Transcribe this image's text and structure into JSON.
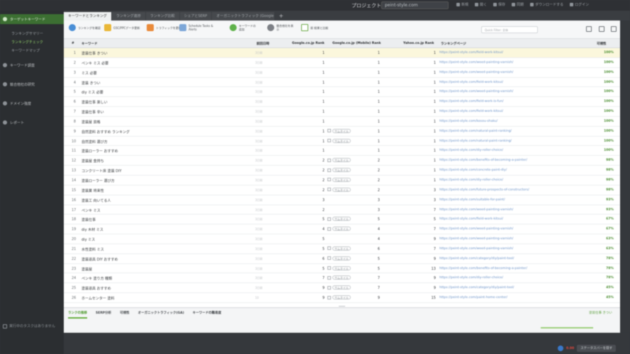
{
  "top": {
    "project_label": "プロジェクト：",
    "project_value": "peint-style.com",
    "actions": [
      "新規",
      "開く",
      "保存",
      "同期",
      "ダウンロードする",
      "ログイン"
    ]
  },
  "sidebar": {
    "category_active": "ターゲットキーワード",
    "subitems": [
      "ランキングサマリー",
      "ランキングチェック",
      "キーワードマップ"
    ],
    "categories": [
      "キーワード調査",
      "競合他社の研究",
      "ドメイン強度",
      "レポート"
    ],
    "bottom_label": "実行中のタスクはありません"
  },
  "tabs": [
    "キーワードとランキング",
    "ランキング進捗",
    "ランキング比較",
    "シェアとSERP",
    "オーガニックトラフィック (Google A..."
  ],
  "toolbar": {
    "buttons": [
      "ランキングを確認",
      "GSC/PPCデータ更新",
      "トラフィックを更新",
      "Schedule Tasks & Alerts",
      "キーワードの追加",
      "競合他社を表示",
      "前 結果と比較"
    ],
    "filter_placeholder": "Quick Filter: 全体"
  },
  "columns": {
    "num": "#",
    "keyword": "キーワード",
    "date": "前回日時",
    "google": "Google.co.jp Rank",
    "mobile": "Google.co.jp (Mobile) Rank",
    "yahoo": "Yahoo.co.jp Rank",
    "url": "ランキングページ",
    "visibility": "可視性"
  },
  "thumb_label": "サムネイル",
  "rows": [
    {
      "n": "1",
      "kw": "塗装仕事 きつい",
      "d": "3日前",
      "g": "1",
      "m": "1",
      "y": "1",
      "u": "https://peint-style.com/field-work-kitsui/",
      "v": "100%",
      "t": false
    },
    {
      "n": "2",
      "kw": "ペンキ ミス 必要",
      "d": "3日前",
      "g": "1",
      "m": "1",
      "y": "1",
      "u": "https://peint-style.com/weed-painting-varnish/",
      "v": "100%",
      "t": false
    },
    {
      "n": "3",
      "kw": "ミス 必要",
      "d": "3日前",
      "g": "1",
      "m": "1",
      "y": "1",
      "u": "https://peint-style.com/weed-painting-varnish/",
      "v": "100%",
      "t": false
    },
    {
      "n": "4",
      "kw": "塗装 きつい",
      "d": "3日前",
      "g": "1",
      "m": "1",
      "y": "1",
      "u": "https://peint-style.com/field-work-kitsui/",
      "v": "100%",
      "t": false
    },
    {
      "n": "5",
      "kw": "diy ミス 必要",
      "d": "3日前",
      "g": "1",
      "m": "1",
      "y": "1",
      "u": "https://peint-style.com/weed-painting-varnish/",
      "v": "100%",
      "t": false
    },
    {
      "n": "6",
      "kw": "塗装仕事 楽しい",
      "d": "3日前",
      "g": "1",
      "m": "1",
      "y": "1",
      "u": "https://peint-style.com/field-work-is-fun/",
      "v": "100%",
      "t": false
    },
    {
      "n": "7",
      "kw": "塗装仕事 辛い",
      "d": "3日前",
      "g": "1",
      "m": "1",
      "y": "1",
      "u": "https://peint-style.com/field-work-kitsui/",
      "v": "100%",
      "t": false
    },
    {
      "n": "8",
      "kw": "塗装屋 資格",
      "d": "3日前",
      "g": "1",
      "m": "1",
      "y": "1",
      "u": "https://peint-style.com/kosou-shaku/",
      "v": "100%",
      "t": false
    },
    {
      "n": "9",
      "kw": "自然塗料 おすすめ ランキング",
      "d": "3日前",
      "g": "1",
      "m": "1",
      "y": "1",
      "u": "https://peint-style.com/natural-paint-ranking/",
      "v": "100%",
      "t": true
    },
    {
      "n": "10",
      "kw": "自然塗料 選び方",
      "d": "3日前",
      "g": "1",
      "m": "1",
      "y": "1",
      "u": "https://peint-style.com/natural-paint-ranking/",
      "v": "100%",
      "t": true
    },
    {
      "n": "11",
      "kw": "塗装ローラー おすすめ",
      "d": "3日前",
      "g": "1",
      "m": "1",
      "y": "1",
      "u": "https://peint-style.com/diy-roller-choice/",
      "v": "100%",
      "t": false
    },
    {
      "n": "12",
      "kw": "塗装屋 金持ち",
      "d": "3日前",
      "g": "2",
      "m": "2",
      "y": "1",
      "u": "https://peint-style.com/benefits-of-becoming-a-painter/",
      "v": "98%",
      "t": true
    },
    {
      "n": "13",
      "kw": "コンクリート床 塗装 DIY",
      "d": "3日前",
      "g": "2",
      "m": "2",
      "y": "1",
      "u": "https://peint-style.com/concrete-paint-diy/",
      "v": "98%",
      "t": true
    },
    {
      "n": "14",
      "kw": "塗装ローラー 選び方",
      "d": "3日前",
      "g": "2",
      "m": "2",
      "y": "1",
      "u": "https://peint-style.com/diy-roller-choice/",
      "v": "98%",
      "t": true
    },
    {
      "n": "15",
      "kw": "塗装業 将来性",
      "d": "3日前",
      "g": "2",
      "m": "2",
      "y": "3",
      "u": "https://peint-style.com/future-prospects-of-constructors/",
      "v": "98%",
      "t": true
    },
    {
      "n": "16",
      "kw": "塗装工 向いてる人",
      "d": "3日前",
      "g": "3",
      "m": "3",
      "y": "3",
      "u": "https://peint-style.com/suitable-for-paint/",
      "v": "93%",
      "t": false
    },
    {
      "n": "17",
      "kw": "ペンキ ミス",
      "d": "3日前",
      "g": "2",
      "m": "3",
      "y": "7",
      "u": "https://peint-style.com/weed-painting-varnish/",
      "v": "93%",
      "t": false
    },
    {
      "n": "18",
      "kw": "塗装仕事",
      "d": "3日前",
      "g": "5",
      "m": "5",
      "y": "5",
      "u": "https://peint-style.com/field-work-kitsui/",
      "v": "67%",
      "t": true
    },
    {
      "n": "19",
      "kw": "diy 木材 ミス",
      "d": "3日前",
      "g": "4",
      "m": "4",
      "y": "7",
      "u": "https://peint-style.com/weed-painting-varnish/",
      "v": "67%",
      "t": true
    },
    {
      "n": "20",
      "kw": "diy ミス",
      "d": "3日前",
      "g": "5",
      "m": "4",
      "y": "9",
      "u": "https://peint-style.com/weed-painting-varnish/",
      "v": "63%",
      "t": false
    },
    {
      "n": "21",
      "kw": "水性塗料 ミス",
      "d": "3日前",
      "g": "5",
      "m": "6",
      "y": "7",
      "u": "https://peint-style.com/weed-painting-varnish/",
      "v": "63%",
      "t": true
    },
    {
      "n": "22",
      "kw": "塗装道具 DIY おすすめ",
      "d": "3日前",
      "g": "6",
      "m": "5",
      "y": "9",
      "u": "https://peint-style.com/category/diy/paint-tool/",
      "v": "78%",
      "t": true
    },
    {
      "n": "23",
      "kw": "塗装屋",
      "d": "3日前",
      "g": "5",
      "m": "5",
      "y": "13",
      "u": "https://peint-style.com/benefits-of-becoming-a-painter/",
      "v": "78%",
      "t": true
    },
    {
      "n": "24",
      "kw": "ペンキ 塗り方 種類",
      "d": "3日前",
      "g": "7",
      "m": "7",
      "y": "9",
      "u": "https://peint-style.com/diy-roller-choice/",
      "v": "78%",
      "t": true
    },
    {
      "n": "25",
      "kw": "塗装道具 おすすめ",
      "d": "3日前",
      "g": "9",
      "m": "7",
      "y": "9",
      "u": "https://peint-style.com/category/diy/paint-tool/",
      "v": "45%",
      "t": true
    },
    {
      "n": "26",
      "kw": "ホームセンター 塗料",
      "d": "10",
      "g": "9",
      "m": "9",
      "y": "15",
      "u": "https://peint-style.com/paint-home-center/",
      "v": "45%",
      "t": true
    }
  ],
  "bottom_panel": {
    "tabs": [
      "ランクの推移",
      "SERP分析",
      "可視性",
      "オーガニックトラフィック(GA)",
      "キーワードの難易度"
    ],
    "right_label": "塗装仕事 きつい"
  },
  "status": {
    "count": "0.00",
    "button": "ステータスバーを隠す"
  },
  "colors": {
    "accent_green": "#4e9a2e",
    "highlight_row": "#fbf7dc",
    "link_blue": "#6c93c8"
  }
}
